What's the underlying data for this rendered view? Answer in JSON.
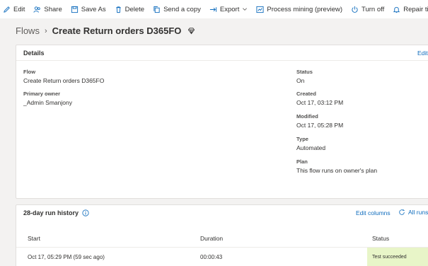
{
  "toolbar": {
    "items": [
      {
        "label": "Edit",
        "icon": "pencil-icon"
      },
      {
        "label": "Share",
        "icon": "people-icon"
      },
      {
        "label": "Save As",
        "icon": "save-icon"
      },
      {
        "label": "Delete",
        "icon": "trash-icon"
      },
      {
        "label": "Send a copy",
        "icon": "copy-icon"
      },
      {
        "label": "Export",
        "icon": "export-arrow-icon"
      },
      {
        "label": "Process mining (preview)",
        "icon": "process-mining-icon"
      },
      {
        "label": "Turn off",
        "icon": "power-icon"
      },
      {
        "label": "Repair tips off",
        "icon": "bell-icon"
      }
    ]
  },
  "breadcrumb": {
    "parent": "Flows",
    "title": "Create Return orders D365FO"
  },
  "details": {
    "title": "Details",
    "edit_label": "Edit",
    "flow_label": "Flow",
    "flow_value": "Create Return orders D365FO",
    "owner_label": "Primary owner",
    "owner_value": "_Admin Smanjony",
    "status_label": "Status",
    "status_value": "On",
    "created_label": "Created",
    "created_value": "Oct 17, 03:12 PM",
    "modified_label": "Modified",
    "modified_value": "Oct 17, 05:28 PM",
    "type_label": "Type",
    "type_value": "Automated",
    "plan_label": "Plan",
    "plan_value": "This flow runs on owner's plan"
  },
  "run_history": {
    "title": "28-day run history",
    "edit_columns_label": "Edit columns",
    "all_runs_label": "All runs",
    "columns": [
      "Start",
      "Duration",
      "Status"
    ],
    "rows": [
      {
        "start": "Oct 17, 05:29 PM (59 sec ago)",
        "duration": "00:00:43",
        "status": "Test succeeded"
      }
    ]
  },
  "colors": {
    "link": "#0f6cbd",
    "success_bg": "#e8f5c8",
    "toolbar_icon": "#0f6cbd"
  }
}
